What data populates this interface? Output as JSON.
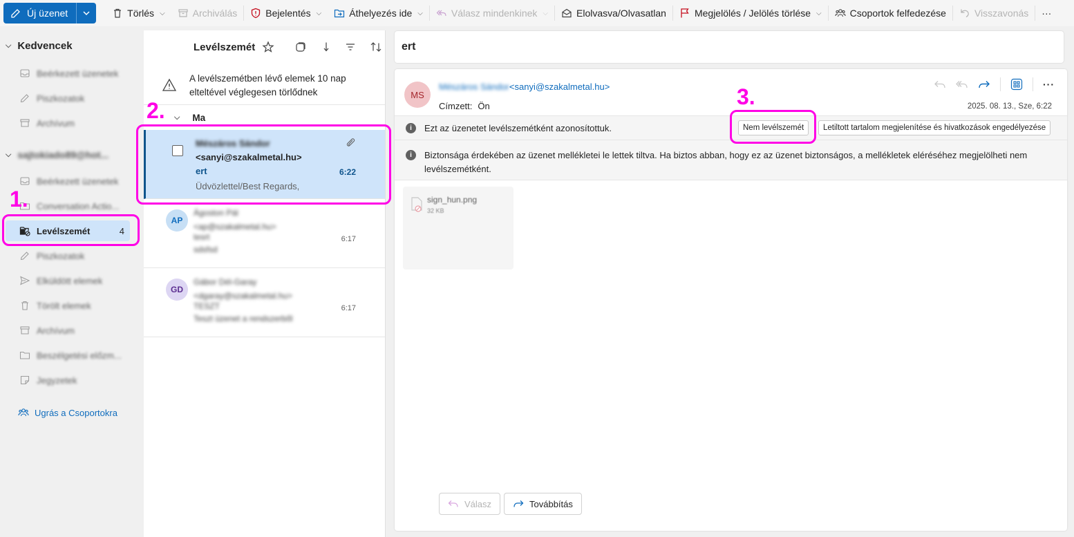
{
  "toolbar": {
    "new_mail": "Új üzenet",
    "delete": "Törlés",
    "archive": "Archiválás",
    "report": "Bejelentés",
    "move_to": "Áthelyezés ide",
    "reply_all": "Válasz mindenkinek",
    "read_unread": "Elolvasva/Olvasatlan",
    "flag": "Megjelölés / Jelölés törlése",
    "discover_groups": "Csoportok felfedezése",
    "undo": "Visszavonás",
    "more": "···"
  },
  "sidebar": {
    "favorites_title": "Kedvencek",
    "favorites": [
      {
        "label": "Beérkezett üzenetek"
      },
      {
        "label": "Piszkozatok"
      },
      {
        "label": "Archívum"
      }
    ],
    "account": "sajtokiado89@hot...",
    "folders": [
      {
        "label": "Beérkezett üzenetek"
      },
      {
        "label": "Conversation Actio..."
      },
      {
        "label": "Levélszemét",
        "count": "4"
      },
      {
        "label": "Piszkozatok"
      },
      {
        "label": "Elküldött elemek"
      },
      {
        "label": "Törölt elemek"
      },
      {
        "label": "Archívum"
      },
      {
        "label": "Beszélgetési előzm..."
      },
      {
        "label": "Jegyzetek"
      }
    ],
    "groups_link": "Ugrás a Csoportokra"
  },
  "list": {
    "title": "Levélszemét",
    "warning": "A levélszemétben lévő elemek 10 nap elteltével véglegesen törlődnek",
    "group": "Ma",
    "items": [
      {
        "from": "Mészáros Sándor",
        "email": "<sanyi@szakalmetal.hu>",
        "subject": "ert",
        "time": "6:22",
        "preview": "Üdvözlettel/Best Regards,"
      },
      {
        "initials": "AP",
        "from": "Ágoston Pál",
        "email": "<ap@szakalmetal.hu>",
        "subject": "tesrt",
        "time": "6:17",
        "preview": "sdsfsd"
      },
      {
        "initials": "GD",
        "from": "Gábor Dél-Garay",
        "email": "<dgaray@szakalmetal.hu>",
        "subject": "TESZT",
        "time": "6:17",
        "preview": "Teszt üzenet a rendszerből"
      }
    ]
  },
  "reading": {
    "subject": "ert",
    "avatar": "MS",
    "from_name": "Mészáros Sándor",
    "from_email": "<sanyi@szakalmetal.hu>",
    "to_label": "Címzett:",
    "to_value": "Ön",
    "date": "2025. 08. 13., Sze, 6:22",
    "junk_notice": "Ezt az üzenetet levélszemétként azonosítottuk.",
    "not_junk_button": "Nem levélszemét",
    "show_content_button": "Letiltott tartalom megjelenítése és hivatkozások engedélyezése",
    "attach_notice": "Biztonsága érdekében az üzenet mellékletei le lettek tiltva. Ha biztos abban, hogy ez az üzenet biztonságos, a mellékletek eléréséhez megjelölheti nem levélszemétként.",
    "attachment_name": "sign_hun.png",
    "attachment_size": "32 KB",
    "reply": "Válasz",
    "forward": "Továbbítás"
  },
  "annotations": {
    "step1": "1.",
    "step2": "2.",
    "step3": "3.",
    "color": "#ff00e6"
  }
}
